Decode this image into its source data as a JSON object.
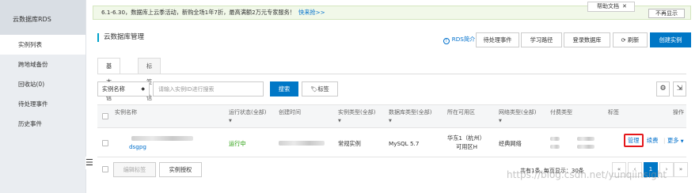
{
  "sidebar": {
    "title": "云数据库RDS",
    "items": [
      {
        "label": "实例列表",
        "active": true
      },
      {
        "label": "跨地域备份",
        "active": false
      },
      {
        "label": "回收站(0)",
        "active": false
      },
      {
        "label": "待处理事件",
        "active": false
      },
      {
        "label": "历史事件",
        "active": false
      }
    ],
    "collapse_glyph": "☰"
  },
  "notice": {
    "text": "6.1-6.30，数据库上云季活动，新购全场1年7折，最高满额2万元专家服务！",
    "link": "快来抢>>",
    "help_doc": "帮助文档",
    "close": "✕",
    "hide_label": "不再显示"
  },
  "header": {
    "title": "云数据库管理",
    "rds_intro": "RDS简介",
    "pending_events": "待处理事件",
    "learning_path": "学习路径",
    "login_db": "登录数据库",
    "refresh": "刷新",
    "create_instance": "创建实例"
  },
  "tabs": [
    {
      "label": "基本信息",
      "active": true
    },
    {
      "label": "标签信息",
      "active": false
    }
  ],
  "toolbar": {
    "select_value": "实例名称",
    "search_placeholder": "请输入实例ID进行搜索",
    "search_label": "搜索",
    "tag_label": "标签"
  },
  "table": {
    "headers": [
      "实例名称",
      "运行状态(全部)",
      "创建时间",
      "实例类型(全部)",
      "数据库类型(全部)",
      "所在可用区",
      "网络类型(全部)",
      "付费类型",
      "标签",
      "操作"
    ],
    "row": {
      "name": "dsgpg",
      "status": "运行中",
      "instance_type": "常规实例",
      "db_type": "MySQL 5.7",
      "zone_line1": "华东1（杭州）",
      "zone_line2": "可用区H",
      "network": "经典网络",
      "actions": {
        "manage": "管理",
        "renew": "续费",
        "more": "更多"
      }
    },
    "footer": {
      "edit_tags": "编辑标签",
      "instance_auth": "实例授权",
      "pagination_text": "共有1条, 每页显示：30条",
      "pages": [
        "«",
        "‹",
        "1",
        "›",
        "»"
      ],
      "current_page": "1"
    }
  },
  "watermark": "https://blog.csdn.net/yunqiinsight",
  "colors": {
    "primary": "#0077c6",
    "link": "#0070cc",
    "running": "#1e9a00",
    "highlight": "#e4171b"
  }
}
